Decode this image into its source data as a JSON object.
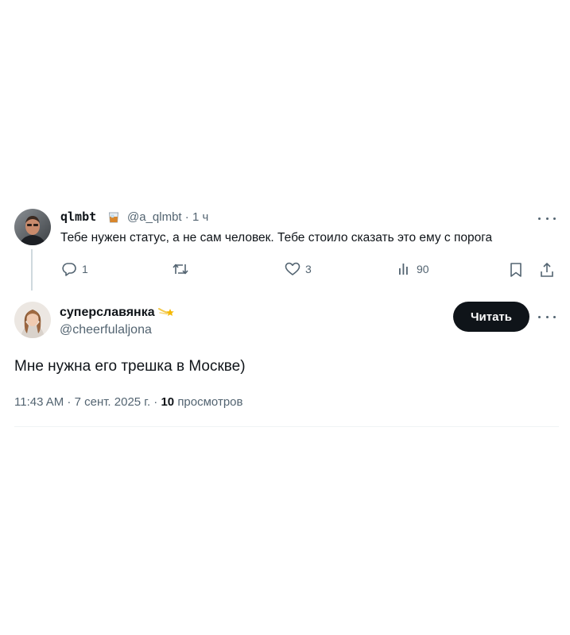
{
  "tweet1": {
    "display_name": "qlmbt",
    "name_emoji_icon": "whiskey-glass-icon",
    "handle": "@a_qlmbt",
    "separator": "·",
    "time": "1 ч",
    "text": "Тебе нужен статус, а не сам человек. Тебе стоило сказать это ему с порога",
    "actions": {
      "reply_count": "1",
      "retweet_count": "",
      "like_count": "3",
      "views_count": "90"
    }
  },
  "tweet2": {
    "display_name": "суперславянка",
    "name_emoji_icon": "shooting-star-icon",
    "handle": "@cheerfulaljona",
    "follow_label": "Читать",
    "text": "Мне нужна его трешка в Москве)",
    "timestamp": "11:43 AM · 7 сент. 2025 г. ·",
    "views_count": "10",
    "views_label": "просмотров"
  },
  "colors": {
    "text_primary": "#0f1419",
    "text_secondary": "#536471",
    "button_bg": "#0f1419",
    "thread_line": "#cfd9de"
  }
}
